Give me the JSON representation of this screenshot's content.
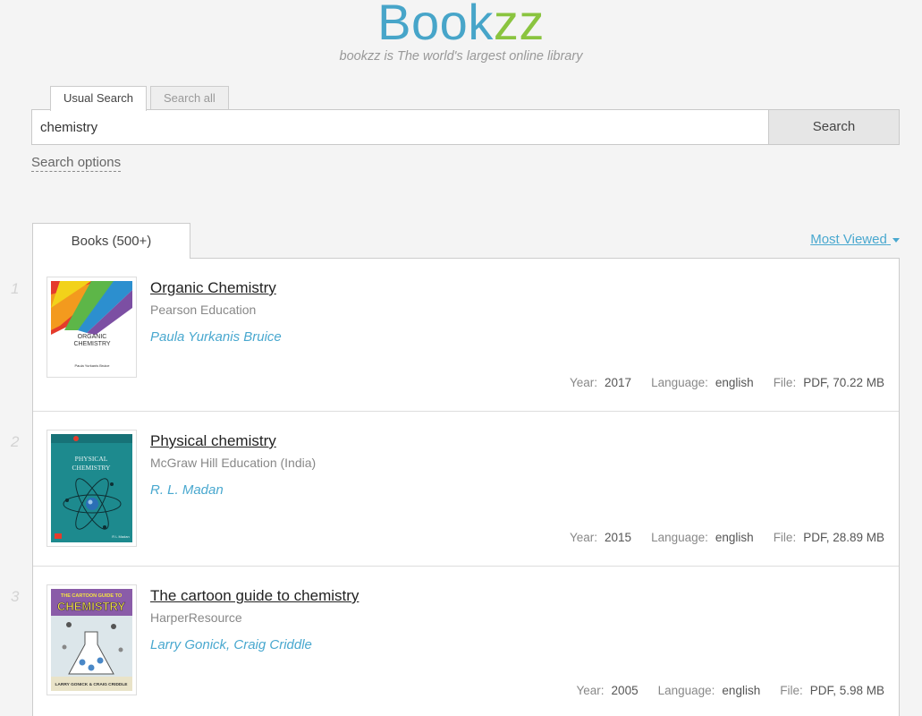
{
  "header": {
    "logo_part1": "Book",
    "logo_part2": "zz",
    "tagline": "bookzz is The world's largest online library"
  },
  "search": {
    "tabs": [
      "Usual Search",
      "Search all"
    ],
    "value": "chemistry",
    "button_label": "Search",
    "options_label": "Search options"
  },
  "results": {
    "tab_label": "Books (500+)",
    "sort_label": "Most Viewed",
    "meta_labels": {
      "year": "Year:",
      "language": "Language:",
      "file": "File:"
    },
    "items": [
      {
        "index": "1",
        "title": "Organic Chemistry",
        "publisher": "Pearson Education",
        "author": "Paula Yurkanis Bruice",
        "year": "2017",
        "language": "english",
        "file": "PDF, 70.22 MB",
        "cover_text": [
          "ORGANIC",
          "CHEMISTRY"
        ],
        "cover_author": "Paula Yurkanis Bruice"
      },
      {
        "index": "2",
        "title": "Physical chemistry",
        "publisher": "McGraw Hill Education (India)",
        "author": "R. L. Madan",
        "year": "2015",
        "language": "english",
        "file": "PDF, 28.89 MB",
        "cover_text": [
          "PHYSICAL",
          "CHEMISTRY"
        ],
        "cover_author": "R L Madan"
      },
      {
        "index": "3",
        "title": "The cartoon guide to chemistry",
        "publisher": "HarperResource",
        "author": "Larry Gonick, Craig Criddle",
        "year": "2005",
        "language": "english",
        "file": "PDF, 5.98 MB",
        "cover_text": [
          "THE CARTOON GUIDE TO",
          "CHEMISTRY"
        ],
        "cover_author": "LARRY GONICK & CRAIG CRIDDLE"
      }
    ]
  },
  "colors": {
    "logo_blue": "#47a5c9",
    "logo_green": "#8ac43f",
    "link_blue": "#49a8cf"
  }
}
